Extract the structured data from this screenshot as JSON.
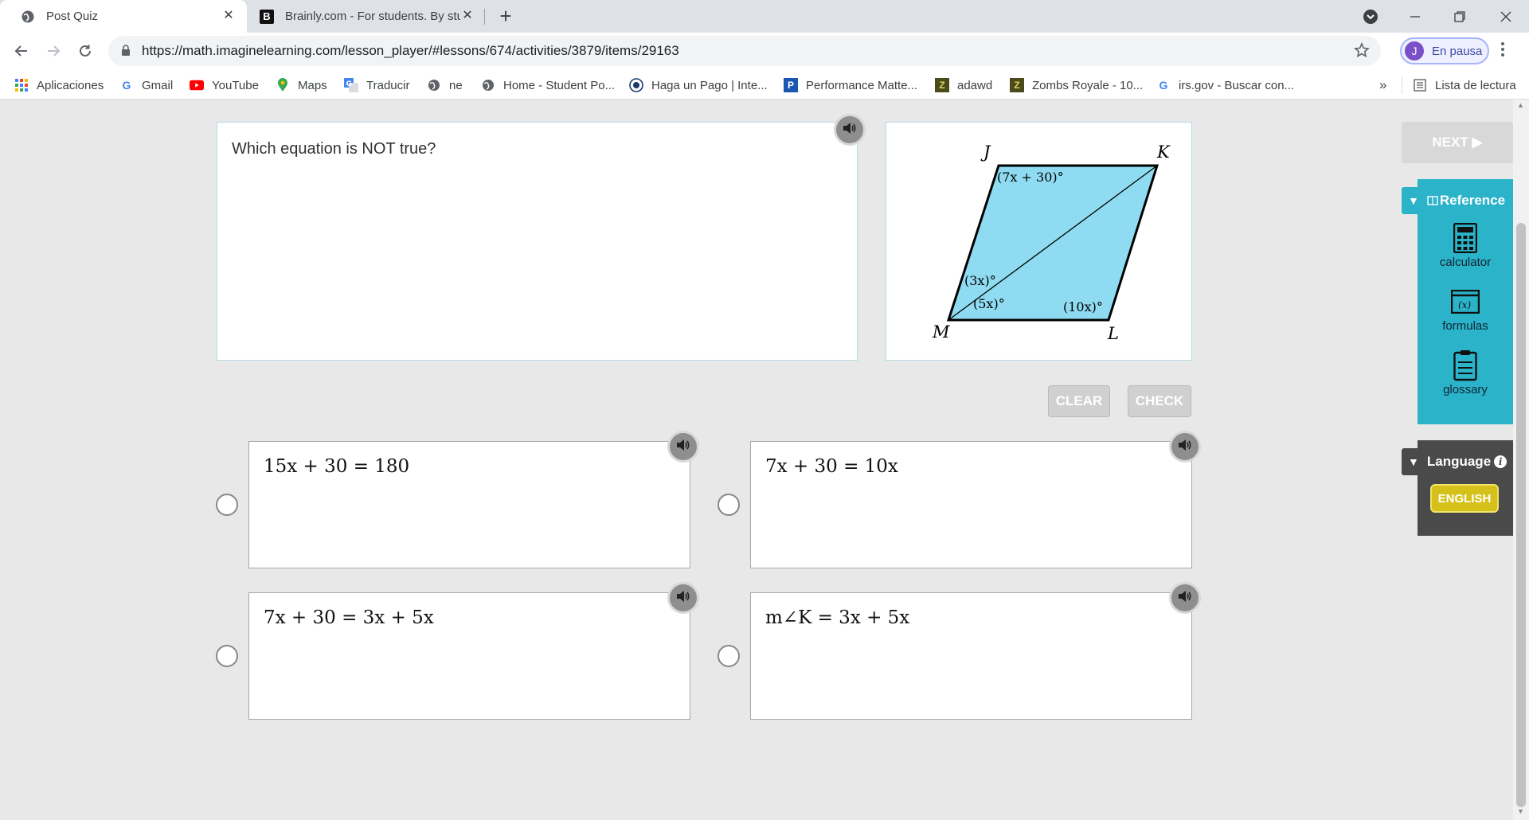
{
  "browser": {
    "tabs": [
      {
        "title": "Post Quiz",
        "active": true
      },
      {
        "title": "Brainly.com - For students. By stu",
        "active": false
      }
    ],
    "url": "https://math.imaginelearning.com/lesson_player/#lessons/674/activities/3879/items/29163",
    "profile_initial": "J",
    "profile_label": "En pausa",
    "bookmarks": [
      {
        "label": "Aplicaciones",
        "icon": "apps-grid-icon"
      },
      {
        "label": "Gmail",
        "icon": "google-icon"
      },
      {
        "label": "YouTube",
        "icon": "youtube-icon"
      },
      {
        "label": "Maps",
        "icon": "maps-pin-icon"
      },
      {
        "label": "Traducir",
        "icon": "translate-icon"
      },
      {
        "label": "ne",
        "icon": "globe-icon"
      },
      {
        "label": "Home - Student Po...",
        "icon": "globe-icon"
      },
      {
        "label": "Haga un Pago | Inte...",
        "icon": "seal-icon"
      },
      {
        "label": "Performance Matte...",
        "icon": "p-icon"
      },
      {
        "label": "adawd",
        "icon": "z-icon"
      },
      {
        "label": "Zombs Royale - 10...",
        "icon": "z-icon"
      },
      {
        "label": "irs.gov - Buscar con...",
        "icon": "google-icon"
      }
    ],
    "more_bookmarks": "»",
    "reading_list": "Lista de lectura"
  },
  "quiz": {
    "prompt": "Which equation is NOT true?",
    "figure": {
      "vertex_j": "J",
      "vertex_k": "K",
      "vertex_l": "L",
      "vertex_m": "M",
      "angle_j": "(7x + 30)°",
      "angle_m_upper": "(3x)°",
      "angle_m_lower": "(5x)°",
      "angle_l": "(10x)°",
      "fill_color": "#8fdcf2"
    },
    "clear_label": "CLEAR",
    "check_label": "CHECK",
    "choices": [
      {
        "equation": "15x + 30 = 180"
      },
      {
        "equation": "7x + 30 = 10x"
      },
      {
        "equation": "7x + 30 = 3x + 5x"
      },
      {
        "equation": "m∠K = 3x + 5x"
      }
    ]
  },
  "sidebar": {
    "next_label": "NEXT ▶",
    "reference_label": "Reference",
    "reference_items": [
      {
        "label": "calculator",
        "icon": "calculator-icon"
      },
      {
        "label": "formulas",
        "icon": "formulas-icon"
      },
      {
        "label": "glossary",
        "icon": "glossary-icon"
      }
    ],
    "language_label": "Language",
    "language_button": "ENGLISH"
  },
  "colors": {
    "accent_teal": "#2ab3c9",
    "language_yellow": "#d6c11a"
  }
}
